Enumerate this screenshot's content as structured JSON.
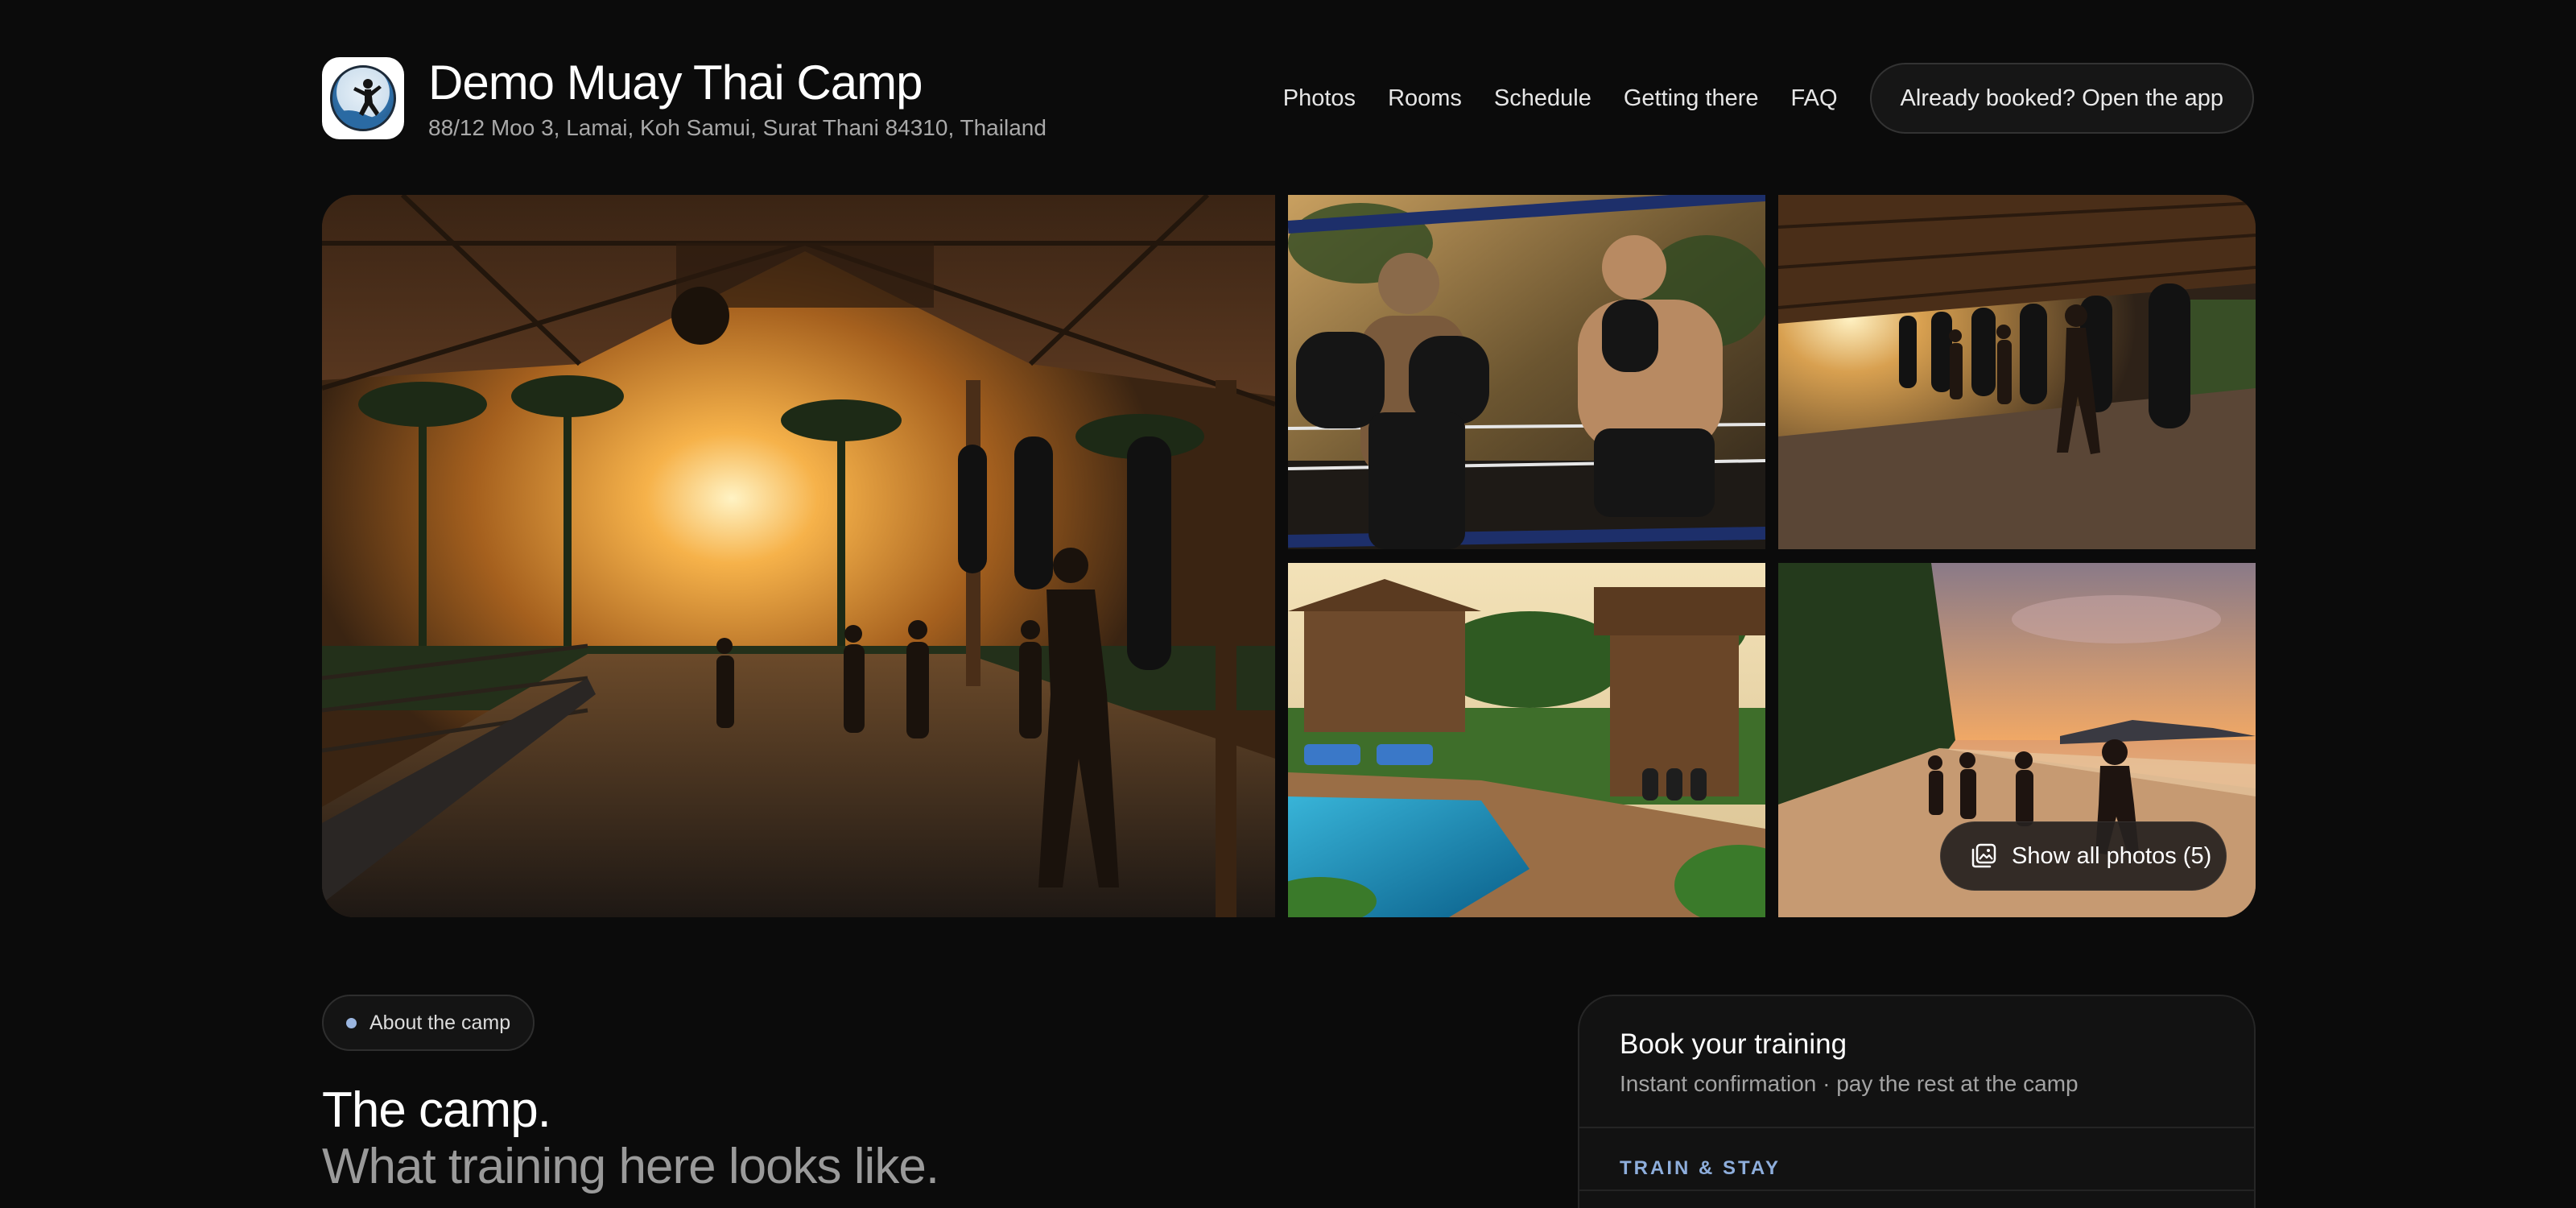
{
  "header": {
    "logo_icon": "muay-thai-fighter-logo-icon",
    "title": "Demo Muay Thai Camp",
    "address": "88/12 Moo 3, Lamai, Koh Samui, Surat Thani 84310, Thailand",
    "nav": [
      "Photos",
      "Rooms",
      "Schedule",
      "Getting there",
      "FAQ"
    ],
    "app_button": "Already booked? Open the app"
  },
  "gallery": {
    "photos": [
      "open-air-gym-sunset-photo",
      "pad-work-in-ring-photo",
      "heavy-bag-row-photo",
      "pool-and-bungalows-photo",
      "beach-run-sunset-photo"
    ],
    "show_all_label": "Show all photos (5)",
    "show_all_icon": "photo-stack-icon"
  },
  "about": {
    "pill_label": "About the camp",
    "heading_line1": "The camp.",
    "heading_line2": "What training here looks like."
  },
  "booking": {
    "title": "Book your training",
    "subtitle": "Instant confirmation · pay the rest at the camp",
    "section_label": "TRAIN & STAY"
  },
  "colors": {
    "background": "#0b0b0b",
    "accent_dot": "#9bb6e0",
    "section_label": "#8eaedc"
  }
}
